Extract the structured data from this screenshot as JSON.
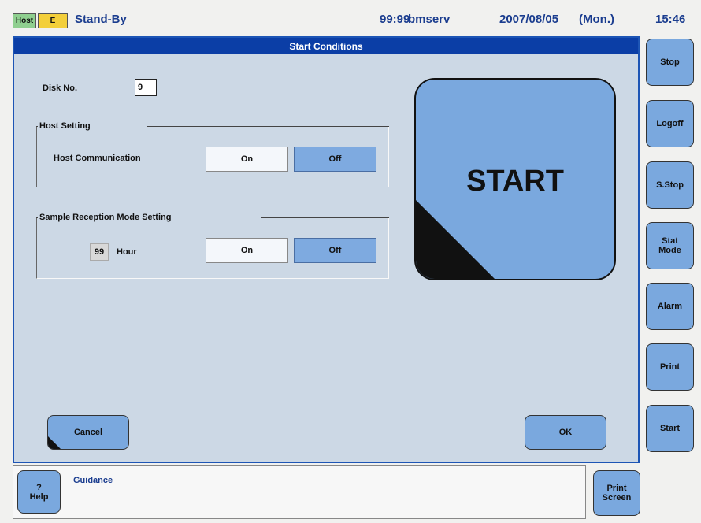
{
  "header": {
    "host_tag": "Host",
    "e_tag": "E",
    "state": "Stand-By",
    "code": "99:99",
    "user": "bmserv",
    "date": "2007/08/05",
    "day": "(Mon.)",
    "time": "15:46"
  },
  "panel": {
    "title": "Start Conditions",
    "disk_label": "Disk No.",
    "disk_value": "9",
    "host_group_title": "Host Setting",
    "host_comm_label": "Host Communication",
    "host_on": "On",
    "host_off": "Off",
    "sample_group_title": "Sample Reception Mode Setting",
    "hour_value": "99",
    "hour_label": "Hour",
    "sample_on": "On",
    "sample_off": "Off",
    "start_big": "START",
    "cancel": "Cancel",
    "ok": "OK"
  },
  "sidebar": {
    "stop": "Stop",
    "logoff": "Logoff",
    "sstop": "S.Stop",
    "stat_mode_line1": "Stat",
    "stat_mode_line2": "Mode",
    "alarm": "Alarm",
    "print": "Print",
    "start": "Start"
  },
  "footer": {
    "help_line1": "?",
    "help_line2": "Help",
    "guidance": "Guidance",
    "print_screen_line1": "Print",
    "print_screen_line2": "Screen"
  },
  "colors": {
    "panel_bg": "#ccd8e5",
    "title_bar": "#0b3ea6",
    "button_blue": "#7aa8de",
    "host_tag": "#8fcf8f",
    "e_tag": "#f3cf3a"
  }
}
